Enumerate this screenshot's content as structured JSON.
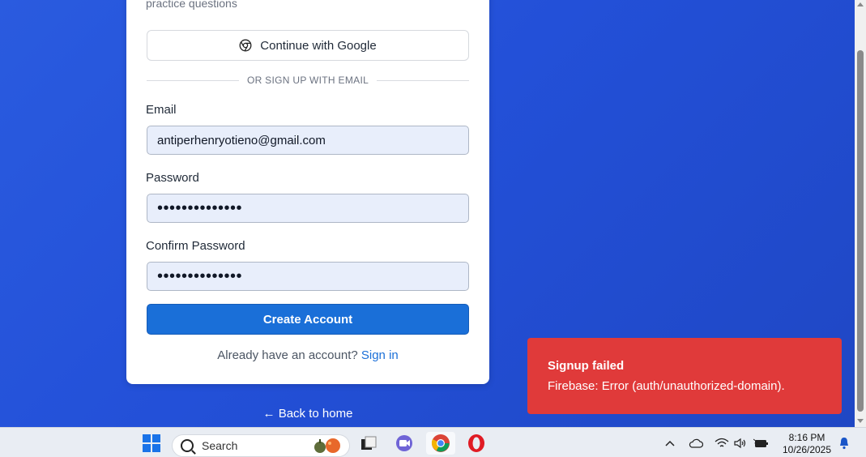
{
  "card": {
    "subtitle": "practice questions",
    "google_button": "Continue with Google",
    "divider_text": "OR SIGN UP WITH EMAIL",
    "email_label": "Email",
    "email_value": "antiperhenryotieno@gmail.com",
    "password_label": "Password",
    "password_value": "••••••••••••••",
    "confirm_label": "Confirm Password",
    "confirm_value": "••••••••••••••",
    "create_button": "Create Account",
    "signin_prompt": "Already have an account?",
    "signin_link": "Sign in"
  },
  "back_home": "← Back to home",
  "toast": {
    "title": "Signup failed",
    "message": "Firebase: Error (auth/unauthorized-domain)."
  },
  "taskbar": {
    "search_placeholder": "Search",
    "time": "8:16 PM",
    "date": "10/26/2025",
    "apps": [
      "windows-start",
      "search",
      "file-explorer",
      "teams",
      "chrome",
      "opera"
    ],
    "tray_icons": [
      "chevron-up-icon",
      "cloud-icon",
      "wifi-icon",
      "volume-icon",
      "battery-icon",
      "notification-bell-icon"
    ]
  },
  "colors": {
    "background": "#2350d8",
    "primary_button": "#1a6fd8",
    "toast": "#e03a3a",
    "input_bg": "#e8eefb"
  }
}
